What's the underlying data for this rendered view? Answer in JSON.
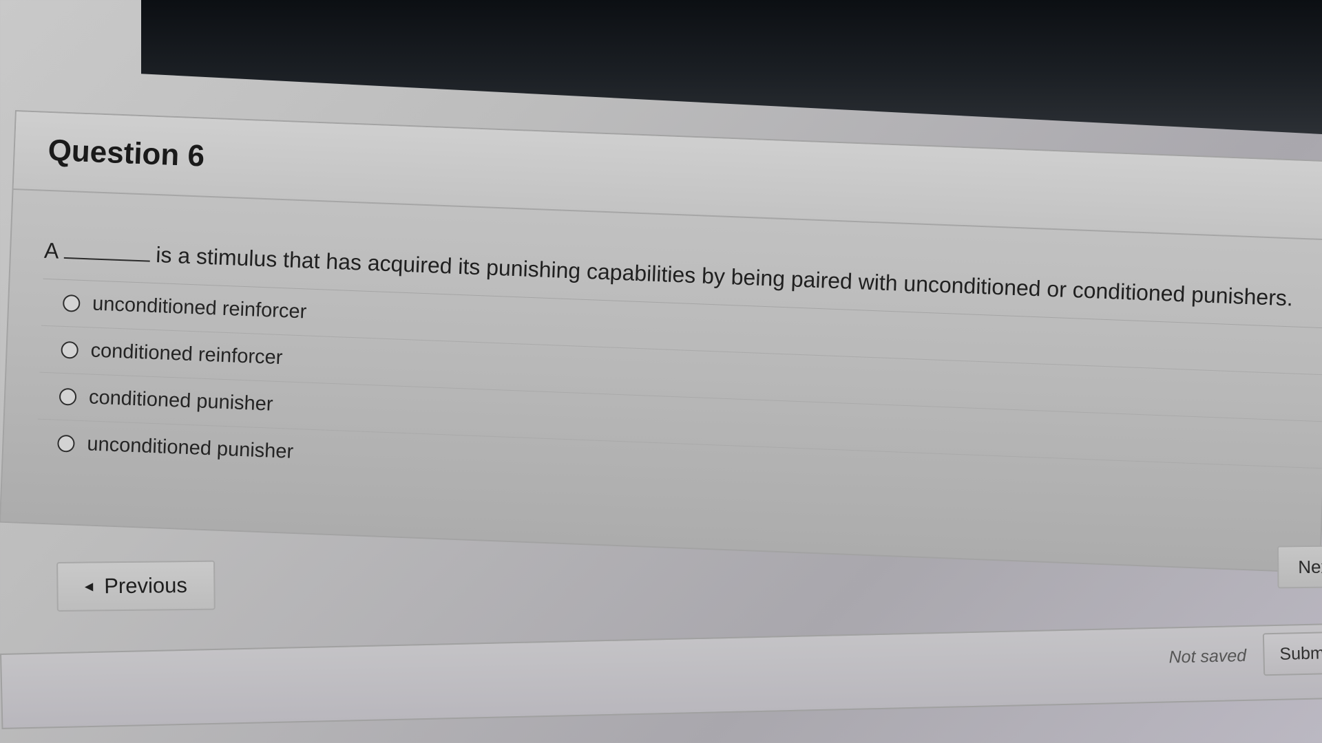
{
  "question": {
    "title": "Question 6",
    "prefix": "A",
    "text": "is a stimulus that has acquired its punishing capabilities by being paired with unconditioned or conditioned punishers."
  },
  "options": [
    {
      "label": "unconditioned reinforcer",
      "selected": false
    },
    {
      "label": "conditioned reinforcer",
      "selected": false
    },
    {
      "label": "conditioned punisher",
      "selected": false
    },
    {
      "label": "unconditioned punisher",
      "selected": false
    }
  ],
  "navigation": {
    "previous_label": "Previous",
    "next_label": "Next"
  },
  "footer": {
    "save_status": "Not saved",
    "submit_label": "Submit"
  }
}
